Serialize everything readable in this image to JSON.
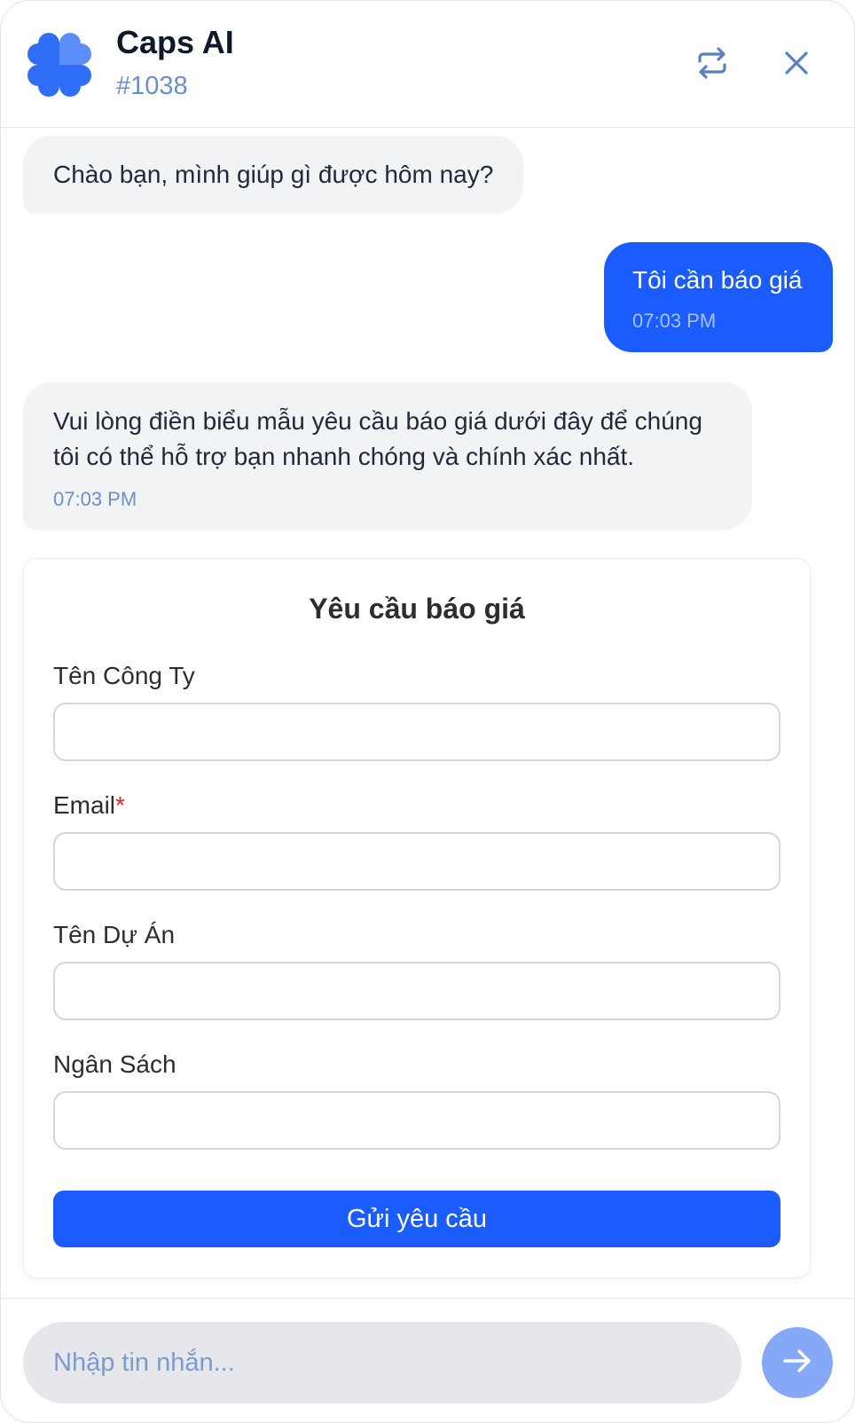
{
  "header": {
    "title": "Caps AI",
    "subtitle": "#1038"
  },
  "messages": [
    {
      "role": "bot",
      "text": "Chào bạn, mình giúp gì được hôm nay?"
    },
    {
      "role": "user",
      "text": "Tôi cần báo giá",
      "time": "07:03 PM"
    },
    {
      "role": "bot",
      "text": "Vui lòng điền biểu mẫu yêu cầu báo giá dưới đây để chúng tôi có thể hỗ trợ bạn nhanh chóng và chính xác nhất.",
      "time": "07:03 PM"
    }
  ],
  "form": {
    "title": "Yêu cầu báo giá",
    "fields": [
      {
        "label": "Tên Công Ty",
        "value": ""
      },
      {
        "label": "Email",
        "required_mark": "*",
        "value": ""
      },
      {
        "label": "Tên Dự Án",
        "value": ""
      },
      {
        "label": "Ngân Sách",
        "value": ""
      }
    ],
    "submit_label": "Gửi yêu cầu"
  },
  "composer": {
    "placeholder": "Nhập tin nhắn...",
    "value": ""
  },
  "colors": {
    "brand": "#1a5cff",
    "logo": "#2f6df6",
    "send_button": "#86a9f7",
    "required": "#d62525"
  },
  "icons": {
    "logo": "clover-logo-icon",
    "refresh": "refresh-icon",
    "close": "close-icon",
    "send": "arrow-right-icon"
  }
}
